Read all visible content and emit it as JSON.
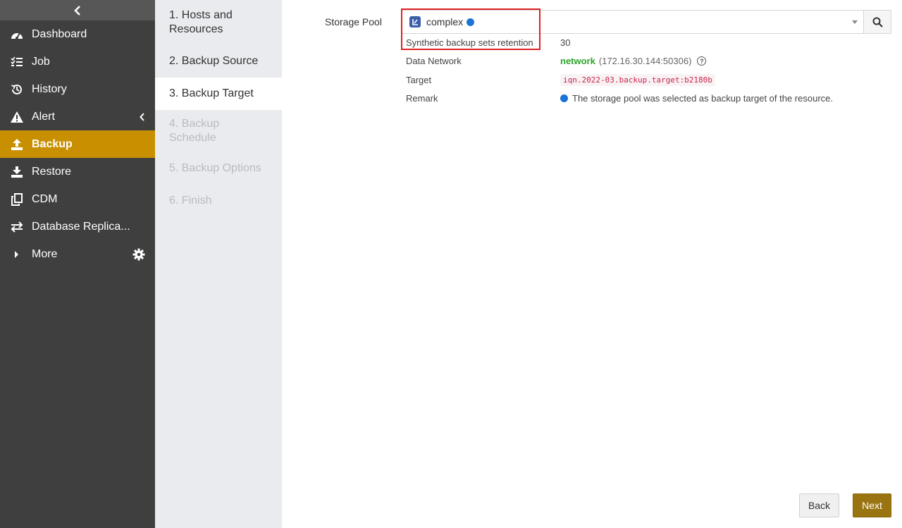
{
  "sidebar": {
    "items": [
      {
        "label": "Dashboard",
        "icon": "dashboard-icon"
      },
      {
        "label": "Job",
        "icon": "job-list-icon"
      },
      {
        "label": "History",
        "icon": "history-icon"
      },
      {
        "label": "Alert",
        "icon": "alert-icon"
      },
      {
        "label": "Backup",
        "icon": "upload-icon"
      },
      {
        "label": "Restore",
        "icon": "download-icon"
      },
      {
        "label": "CDM",
        "icon": "copy-icon"
      },
      {
        "label": "Database Replica...",
        "icon": "replication-icon"
      },
      {
        "label": "More",
        "icon": "caret-right-icon"
      }
    ]
  },
  "steps": [
    {
      "label": "1. Hosts and Resources"
    },
    {
      "label": "2. Backup Source"
    },
    {
      "label": "3. Backup Target"
    },
    {
      "label": "4. Backup Schedule"
    },
    {
      "label": "5. Backup Options"
    },
    {
      "label": "6. Finish"
    }
  ],
  "storage_pool": {
    "label": "Storage Pool",
    "selected": "complex"
  },
  "details": {
    "retention_label": "Synthetic backup sets retention",
    "retention_value": "30",
    "network_label": "Data Network",
    "network_name": "network",
    "network_addr": "(172.16.30.144:50306)",
    "target_label": "Target",
    "target_value": "iqn.2022-03.backup.target:b2180b",
    "remark_label": "Remark",
    "remark_value": "The storage pool was selected as backup target of the resource."
  },
  "buttons": {
    "back": "Back",
    "next": "Next"
  },
  "colors": {
    "sidebar_bg": "#3f3f3f",
    "active_bg": "#c88f00",
    "next_bg": "#9a7410",
    "status_blue": "#1b73d3",
    "network_green": "#2ea52e",
    "highlight_red": "#e02020"
  }
}
